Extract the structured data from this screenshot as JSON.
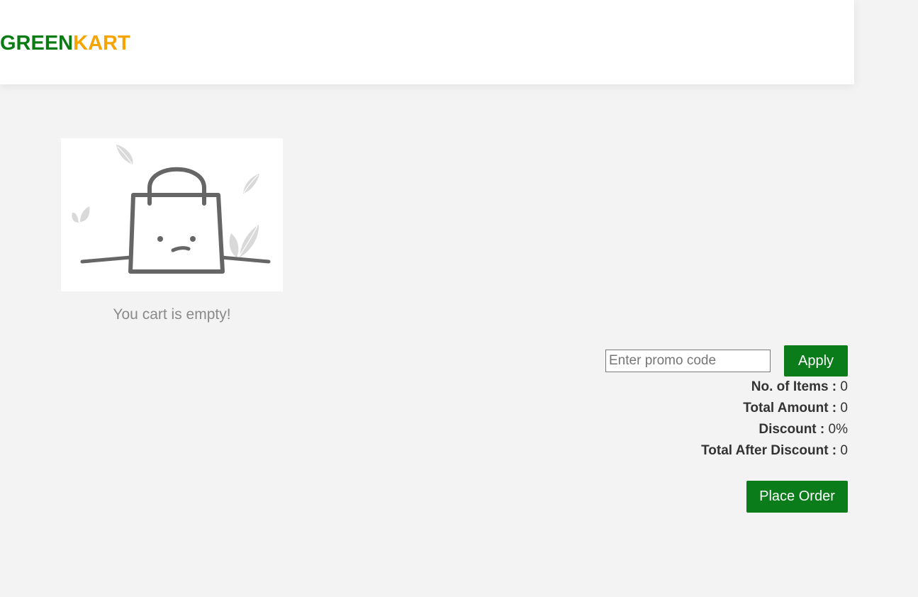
{
  "header": {
    "brand_part1": "GREEN",
    "brand_part2": "KART"
  },
  "cart": {
    "illustration_icon": "empty-shopping-bag-icon",
    "empty_message": "You cart is empty!"
  },
  "promo": {
    "placeholder": "Enter promo code",
    "value": "",
    "apply_label": "Apply"
  },
  "summary": {
    "items_label": "No. of Items :",
    "items_value": "0",
    "total_label": "Total Amount :",
    "total_value": "0",
    "discount_label": "Discount :",
    "discount_value": "0%",
    "after_label": "Total After Discount :",
    "after_value": "0"
  },
  "actions": {
    "place_order_label": "Place Order"
  },
  "colors": {
    "brand_green": "#0a7c13",
    "brand_orange": "#f8a400",
    "button_green": "#0a7c1a",
    "background": "#f3f3f3"
  }
}
